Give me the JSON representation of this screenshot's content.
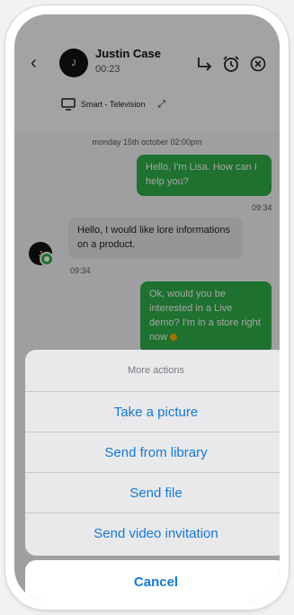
{
  "header": {
    "contact_initial": "J",
    "contact_name": "Justin Case",
    "call_time": "00:23",
    "device_label": "Smart - Television"
  },
  "chat": {
    "date_line": "monday 15th october 02:00pm",
    "messages": [
      {
        "direction": "out",
        "text": "Hello, I'm Lisa. How can I help you?",
        "time": "09:34"
      },
      {
        "direction": "in",
        "text": "Hello, I would like lore informations on a product.",
        "time": "09:34",
        "sender_initial": "J"
      },
      {
        "direction": "out",
        "text": "Ok, would you be interested in a Live demo? I'm in a store right now"
      }
    ]
  },
  "action_sheet": {
    "title": "More actions",
    "items": [
      {
        "label": "Take a picture"
      },
      {
        "label": "Send from library"
      },
      {
        "label": "Send file"
      },
      {
        "label": "Send video invitation"
      }
    ],
    "cancel_label": "Cancel"
  },
  "colors": {
    "accent_green": "#2eae47",
    "action_blue": "#1479d6"
  },
  "icons": {
    "back": "chevron-left-icon",
    "transfer": "transfer-icon",
    "alarm": "alarm-clock-icon",
    "close": "close-circle-icon",
    "tv": "tv-icon",
    "expand": "expand-icon"
  }
}
